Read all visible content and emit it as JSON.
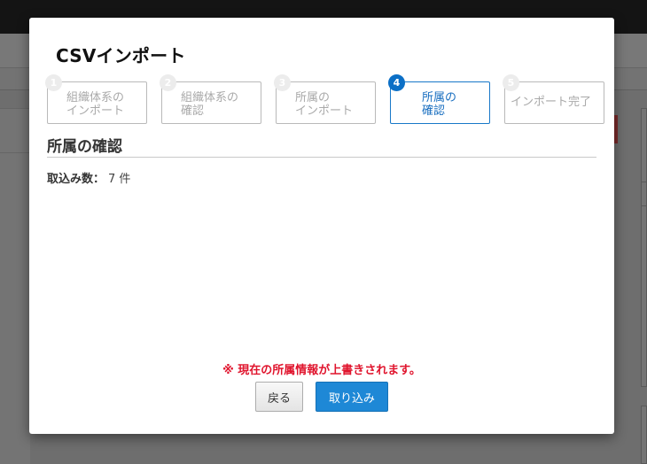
{
  "dialog": {
    "title": "CSVインポート",
    "steps": [
      {
        "number": "1",
        "label": "組織体系の\nインポート",
        "state": "inactive"
      },
      {
        "number": "2",
        "label": "組織体系の\n確認",
        "state": "inactive"
      },
      {
        "number": "3",
        "label": "所属の\nインポート",
        "state": "inactive"
      },
      {
        "number": "4",
        "label": "所属の\n確認",
        "state": "active"
      },
      {
        "number": "5",
        "label": "インポート完了",
        "state": "inactive"
      }
    ],
    "section_title": "所属の確認",
    "import_count": {
      "label": "取込み数：",
      "value": "7 件"
    },
    "warning": "※ 現在の所属情報が上書きされます。",
    "buttons": {
      "back": "戻る",
      "import": "取り込み"
    }
  },
  "colors": {
    "accent": "#1e88d6",
    "active_step": "#0b6fc6",
    "warning": "#e0142d",
    "overlay": "#6e6e6e"
  }
}
